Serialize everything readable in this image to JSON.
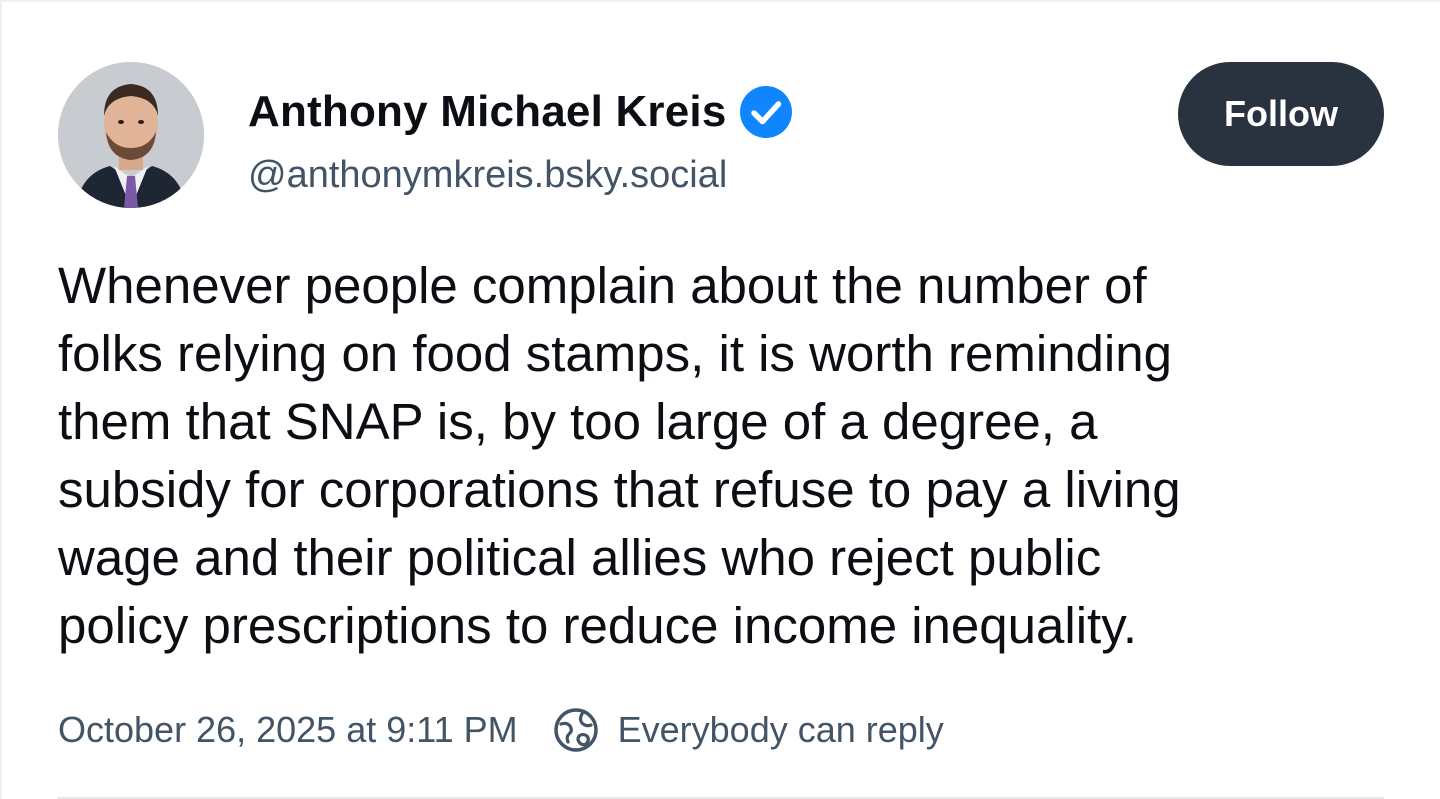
{
  "author": {
    "display_name": "Anthony Michael Kreis",
    "handle": "@anthonymkreis.bsky.social",
    "verified_icon": "verified-check-icon"
  },
  "follow_button": {
    "label": "Follow"
  },
  "post": {
    "text_lines": [
      "Whenever people complain about the number of",
      "folks relying on food stamps, it is worth reminding",
      "them that SNAP is, by too large of a degree, a",
      "subsidy for corporations that refuse to pay a living",
      "wage and their political allies who reject public",
      "policy prescriptions to reduce income inequality."
    ]
  },
  "meta": {
    "timestamp": "October 26, 2025 at 9:11 PM",
    "reply_setting": "Everybody can reply",
    "reply_icon": "globe-icon"
  },
  "colors": {
    "text_primary": "#0b0f14",
    "text_secondary": "#425466",
    "follow_bg": "#293340",
    "verified_blue": "#1185fe"
  }
}
